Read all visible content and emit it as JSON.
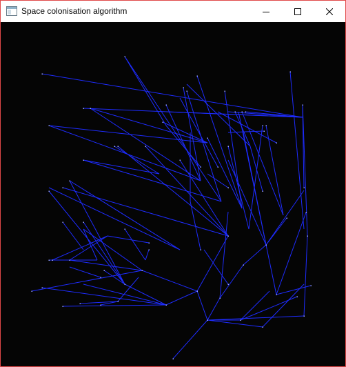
{
  "window": {
    "title": "Space colonisation algorithm",
    "icons": {
      "app": "app-window-icon",
      "minimize": "minimize-icon",
      "maximize": "maximize-icon",
      "close": "close-icon"
    }
  },
  "canvas": {
    "background": "#050505",
    "branch_color": "#1e2cff",
    "attractor_color": "#9aa6ff"
  }
}
